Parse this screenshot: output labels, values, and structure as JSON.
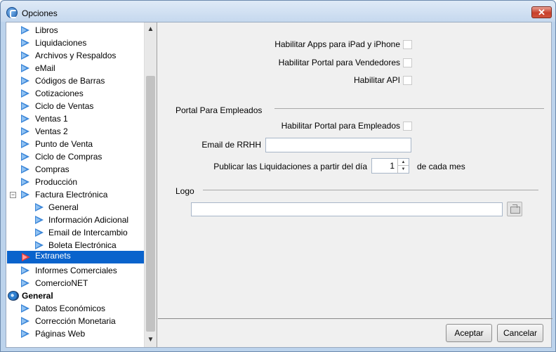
{
  "window": {
    "title": "Opciones",
    "close_glyph": "✕",
    "app_icon": "app-logo-icon"
  },
  "tree": {
    "items": [
      {
        "label": "Libros"
      },
      {
        "label": "Liquidaciones"
      },
      {
        "label": "Archivos y Respaldos"
      },
      {
        "label": "eMail"
      },
      {
        "label": "Códigos de Barras"
      },
      {
        "label": "Cotizaciones"
      },
      {
        "label": "Ciclo de Ventas"
      },
      {
        "label": "Ventas 1"
      },
      {
        "label": "Ventas 2"
      },
      {
        "label": "Punto de Venta"
      },
      {
        "label": "Ciclo de Compras"
      },
      {
        "label": "Compras"
      },
      {
        "label": "Producción"
      },
      {
        "label": "Factura Electrónica"
      },
      {
        "label": "General"
      },
      {
        "label": "Información Adicional"
      },
      {
        "label": "Email de Intercambio"
      },
      {
        "label": "Boleta Electrónica"
      },
      {
        "label": "Extranets"
      },
      {
        "label": "Informes Comerciales"
      },
      {
        "label": "ComercioNET"
      },
      {
        "label": "General"
      },
      {
        "label": "Datos Económicos"
      },
      {
        "label": "Corrección Monetaria"
      },
      {
        "label": "Páginas Web"
      }
    ],
    "expander_glyph": "−",
    "selected_label": "Extranets",
    "scroll_up": "▲",
    "scroll_down": "▼"
  },
  "panel": {
    "ipad_label": "Habilitar Apps para iPad y iPhone",
    "vendedores_label": "Habilitar Portal para Vendedores",
    "api_label": "Habilitar API",
    "empleados_group": "Portal Para Empleados",
    "empleados_label": "Habilitar Portal para Empleados",
    "email_rrhh_label": "Email de RRHH",
    "email_rrhh_value": "",
    "publicar_label": "Publicar las Liquidaciones a partir del día",
    "dia_value": "1",
    "cada_mes_label": "de cada mes",
    "logo_group": "Logo",
    "logo_path_value": "",
    "checks": {
      "ipad": false,
      "vendedores": false,
      "api": false,
      "empleados": false
    }
  },
  "buttons": {
    "accept": "Aceptar",
    "cancel": "Cancelar"
  },
  "colors": {
    "selection": "#0a63cc",
    "arrow_blue": "#3b86d8",
    "arrow_red": "#e23a3a"
  }
}
